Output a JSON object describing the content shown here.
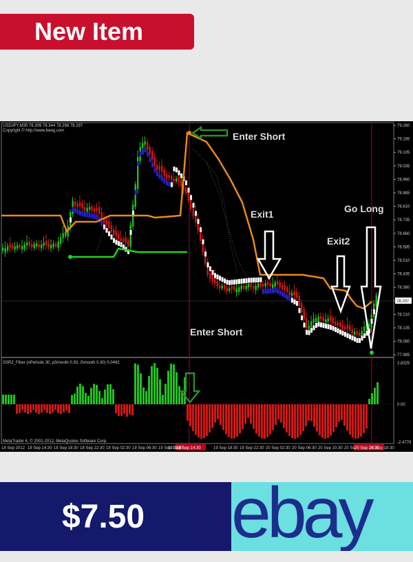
{
  "badge": {
    "label": "New Item"
  },
  "listing": {
    "price": "$7.50",
    "brand": "ebay"
  },
  "chart": {
    "symbol_line": "USDJPY,M30  78.309 78.344 78.298 78.297",
    "copyright_line": "Copyright © http://www.beeg.com",
    "indicator_line": "SSR2_Fiber (nPeriods 30, pSmooth 0.30, iSmooth 0.30)  0.0492",
    "platform_line": "MetaTrader 4, © 2001-2012, MetaQuotes Software Corp.",
    "current_price": "78.297",
    "price_ticks": [
      "79.260",
      "79.185",
      "79.105",
      "79.035",
      "78.960",
      "78.885",
      "78.810",
      "78.735",
      "78.660",
      "78.585",
      "78.510",
      "78.435",
      "78.360",
      "78.285",
      "78.210",
      "78.135",
      "78.060",
      "77.985"
    ],
    "osc_ticks": [
      "2.8325",
      "0.00",
      "-2.4779"
    ],
    "time_ticks": [
      "18 Sep 2012",
      "18 Sep 14:30",
      "18 Sep 18:30",
      "18 Sep 22:30",
      "19 Sep 02:30",
      "19 Sep 06:30",
      "19 Sep 10:30",
      "19 Sep",
      "19 Sep 18:30",
      "19 Sep 22:30",
      "20 Sep 02:30",
      "20 Sep 06:30",
      "20 Sep 10:30",
      "20 Se",
      "20 Sep 18:30"
    ],
    "time_highlight_1": "19 Sep 14:30",
    "time_highlight_2": "20 Sep 14:30",
    "annotations": {
      "enter_short_top": "Enter Short",
      "exit1": "Exit1",
      "exit2": "Exit2",
      "go_long": "Go Long",
      "enter_short_bottom": "Enter Short"
    },
    "colors": {
      "bull": "#22c022",
      "bear": "#d01818",
      "orange": "#e88a1c",
      "green_line": "#1fd21f",
      "blue": "#2222cc",
      "white": "#ffffff",
      "arrow_green": "#2e8b2e",
      "highlight": "#c0001a"
    }
  }
}
